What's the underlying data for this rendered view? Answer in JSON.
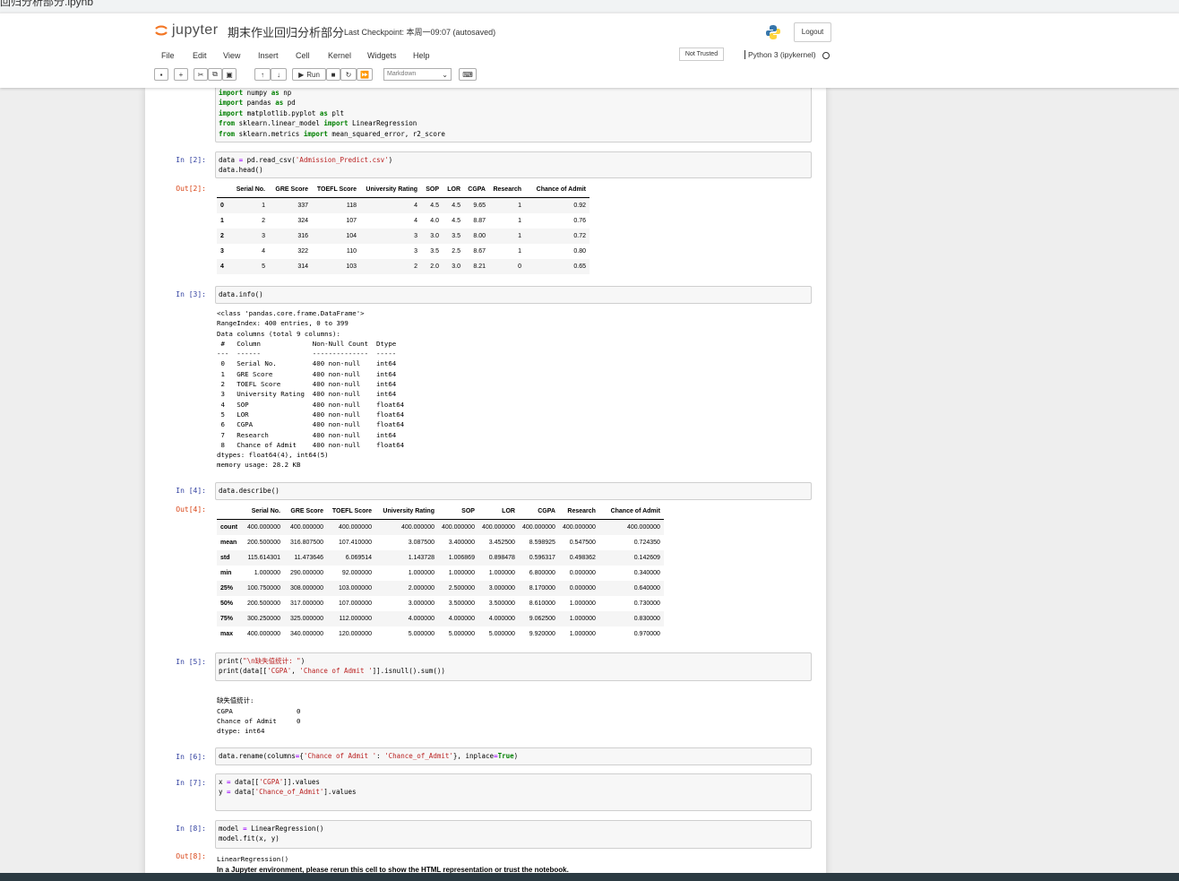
{
  "browser": {
    "tab_title": "回归分析部分.ipynb"
  },
  "header": {
    "logo_text": "jupyter",
    "notebook_name": "期末作业回归分析部分",
    "checkpoint": "Last Checkpoint: 本周一09:07  (autosaved)",
    "logout_label": "Logout"
  },
  "menu": {
    "items": [
      "File",
      "Edit",
      "View",
      "Insert",
      "Cell",
      "Kernel",
      "Widgets",
      "Help"
    ],
    "trust_label": "Not Trusted",
    "kernel_label": "Python 3 (ipykernel)"
  },
  "toolbar": {
    "run_label": "Run",
    "cell_type": "Markdown"
  },
  "cells": {
    "c1": {
      "lines": [
        [
          "import",
          " numpy ",
          "as",
          " np"
        ],
        [
          "import",
          " pandas ",
          "as",
          " pd"
        ],
        [
          "import",
          " matplotlib.pyplot ",
          "as",
          " plt"
        ],
        [
          "from",
          " sklearn.linear_model ",
          "import",
          " LinearRegression"
        ],
        [
          "from",
          " sklearn.metrics ",
          "import",
          " mean_squared_error, r2_score"
        ]
      ]
    },
    "c2": {
      "in_prompt": "In  [2]:",
      "out_prompt": "Out[2]:",
      "code_line1_a": "data ",
      "code_line1_eq": "=",
      "code_line1_b": " pd.read_csv(",
      "code_line1_str": "'Admission_Predict.csv'",
      "code_line1_c": ")",
      "code_line2": "data.head()",
      "table": {
        "columns": [
          "",
          "Serial No.",
          "GRE Score",
          "TOEFL Score",
          "University Rating",
          "SOP",
          "LOR",
          "CGPA",
          "Research",
          "Chance of Admit"
        ],
        "rows": [
          [
            "0",
            "1",
            "337",
            "118",
            "4",
            "4.5",
            "4.5",
            "9.65",
            "1",
            "0.92"
          ],
          [
            "1",
            "2",
            "324",
            "107",
            "4",
            "4.0",
            "4.5",
            "8.87",
            "1",
            "0.76"
          ],
          [
            "2",
            "3",
            "316",
            "104",
            "3",
            "3.0",
            "3.5",
            "8.00",
            "1",
            "0.72"
          ],
          [
            "3",
            "4",
            "322",
            "110",
            "3",
            "3.5",
            "2.5",
            "8.67",
            "1",
            "0.80"
          ],
          [
            "4",
            "5",
            "314",
            "103",
            "2",
            "2.0",
            "3.0",
            "8.21",
            "0",
            "0.65"
          ]
        ]
      }
    },
    "c3": {
      "in_prompt": "In  [3]:",
      "code": "data.info()",
      "output": "<class 'pandas.core.frame.DataFrame'>\nRangeIndex: 400 entries, 0 to 399\nData columns (total 9 columns):\n #   Column             Non-Null Count  Dtype  \n---  ------             --------------  -----  \n 0   Serial No.         400 non-null    int64  \n 1   GRE Score          400 non-null    int64  \n 2   TOEFL Score        400 non-null    int64  \n 3   University Rating  400 non-null    int64  \n 4   SOP                400 non-null    float64\n 5   LOR                400 non-null    float64\n 6   CGPA               400 non-null    float64\n 7   Research           400 non-null    int64  \n 8   Chance of Admit    400 non-null    float64\ndtypes: float64(4), int64(5)\nmemory usage: 28.2 KB"
    },
    "c4": {
      "in_prompt": "In  [4]:",
      "out_prompt": "Out[4]:",
      "code": "data.describe()",
      "table": {
        "columns": [
          "",
          "Serial No.",
          "GRE Score",
          "TOEFL Score",
          "University Rating",
          "SOP",
          "LOR",
          "CGPA",
          "Research",
          "Chance of Admit"
        ],
        "rows": [
          [
            "count",
            "400.000000",
            "400.000000",
            "400.000000",
            "400.000000",
            "400.000000",
            "400.000000",
            "400.000000",
            "400.000000",
            "400.000000"
          ],
          [
            "mean",
            "200.500000",
            "316.807500",
            "107.410000",
            "3.087500",
            "3.400000",
            "3.452500",
            "8.598925",
            "0.547500",
            "0.724350"
          ],
          [
            "std",
            "115.614301",
            "11.473646",
            "6.069514",
            "1.143728",
            "1.006869",
            "0.898478",
            "0.596317",
            "0.498362",
            "0.142609"
          ],
          [
            "min",
            "1.000000",
            "290.000000",
            "92.000000",
            "1.000000",
            "1.000000",
            "1.000000",
            "6.800000",
            "0.000000",
            "0.340000"
          ],
          [
            "25%",
            "100.750000",
            "308.000000",
            "103.000000",
            "2.000000",
            "2.500000",
            "3.000000",
            "8.170000",
            "0.000000",
            "0.640000"
          ],
          [
            "50%",
            "200.500000",
            "317.000000",
            "107.000000",
            "3.000000",
            "3.500000",
            "3.500000",
            "8.610000",
            "1.000000",
            "0.730000"
          ],
          [
            "75%",
            "300.250000",
            "325.000000",
            "112.000000",
            "4.000000",
            "4.000000",
            "4.000000",
            "9.062500",
            "1.000000",
            "0.830000"
          ],
          [
            "max",
            "400.000000",
            "340.000000",
            "120.000000",
            "5.000000",
            "5.000000",
            "5.000000",
            "9.920000",
            "1.000000",
            "0.970000"
          ]
        ]
      }
    },
    "c5": {
      "in_prompt": "In  [5]:",
      "code_l1_a": "print(",
      "code_l1_str": "\"\\n缺失值统计: \"",
      "code_l1_b": ")",
      "code_l2_a": "print(data[[",
      "code_l2_str1": "'CGPA'",
      "code_l2_b": ", ",
      "code_l2_str2": "'Chance of Admit '",
      "code_l2_c": "]].isnull().sum())",
      "output": "\n缺失值统计:\nCGPA                0\nChance of Admit     0\ndtype: int64"
    },
    "c6": {
      "in_prompt": "In  [6]:",
      "code_a": "data.rename(columns",
      "code_eq": "=",
      "code_b": "{",
      "code_str1": "'Chance of Admit '",
      "code_c": ": ",
      "code_str2": "'Chance_of_Admit'",
      "code_d": "}, inplace",
      "code_eq2": "=",
      "code_true": "True",
      "code_e": ")"
    },
    "c7": {
      "in_prompt": "In  [7]:",
      "l1_a": "x ",
      "l1_eq": "=",
      "l1_b": " data[[",
      "l1_str": "'CGPA'",
      "l1_c": "]].values",
      "l2_a": "y ",
      "l2_eq": "=",
      "l2_b": " data[",
      "l2_str": "'Chance_of_Admit'",
      "l2_c": "].values"
    },
    "c8": {
      "in_prompt": "In  [8]:",
      "out_prompt": "Out[8]:",
      "l1_a": "model ",
      "l1_eq": "=",
      "l1_b": " LinearRegression()",
      "l2": "model.fit(x, y)",
      "out_l1": "LinearRegression()",
      "out_l2": "In a Jupyter environment, please rerun this cell to show the HTML representation or trust the notebook."
    }
  }
}
